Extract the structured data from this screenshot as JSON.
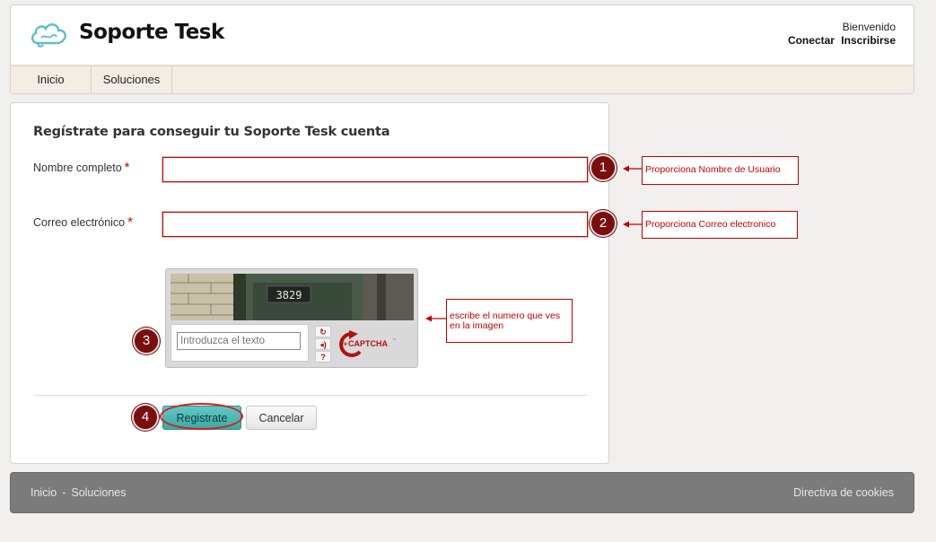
{
  "header": {
    "brand": "Soporte Tesk",
    "welcome": "Bienvenido",
    "login_link": "Conectar",
    "signup_link": "Inscribirse"
  },
  "nav": {
    "items": [
      {
        "label": "Inicio"
      },
      {
        "label": "Soluciones"
      }
    ]
  },
  "form": {
    "title": "Regístrate para conseguir tu Soporte Tesk cuenta",
    "full_name_label": "Nombre completo",
    "email_label": "Correo electrónico",
    "required_mark": "*",
    "full_name_value": "",
    "email_value": "",
    "captcha": {
      "image_text": "3829",
      "placeholder": "Introduzca el texto",
      "logo_text": "reCAPTCHA",
      "logo_small": "re",
      "logo_big": "CAPTCHA",
      "logo_tm": "™",
      "refresh_icon": "refresh-icon",
      "audio_icon": "audio-icon",
      "help_icon": "help-icon"
    },
    "submit_label": "Registrate",
    "cancel_label": "Cancelar"
  },
  "annotations": {
    "badges": [
      "1",
      "2",
      "3",
      "4"
    ],
    "notes": [
      "Proporciona Nombre de Usuario",
      "Proporciona Correo electronico",
      "escribe el numero que ves en la imagen"
    ],
    "color": "#c00000"
  },
  "footer": {
    "links": [
      "Inicio",
      "Soluciones"
    ],
    "separator": "-",
    "cookies": "Directiva de cookies"
  },
  "colors": {
    "primary_button": "#4db5b2",
    "brand_icon": "#5bbfc2",
    "footer_bg": "#7b7b7b",
    "nav_bg": "#f4ede3"
  }
}
